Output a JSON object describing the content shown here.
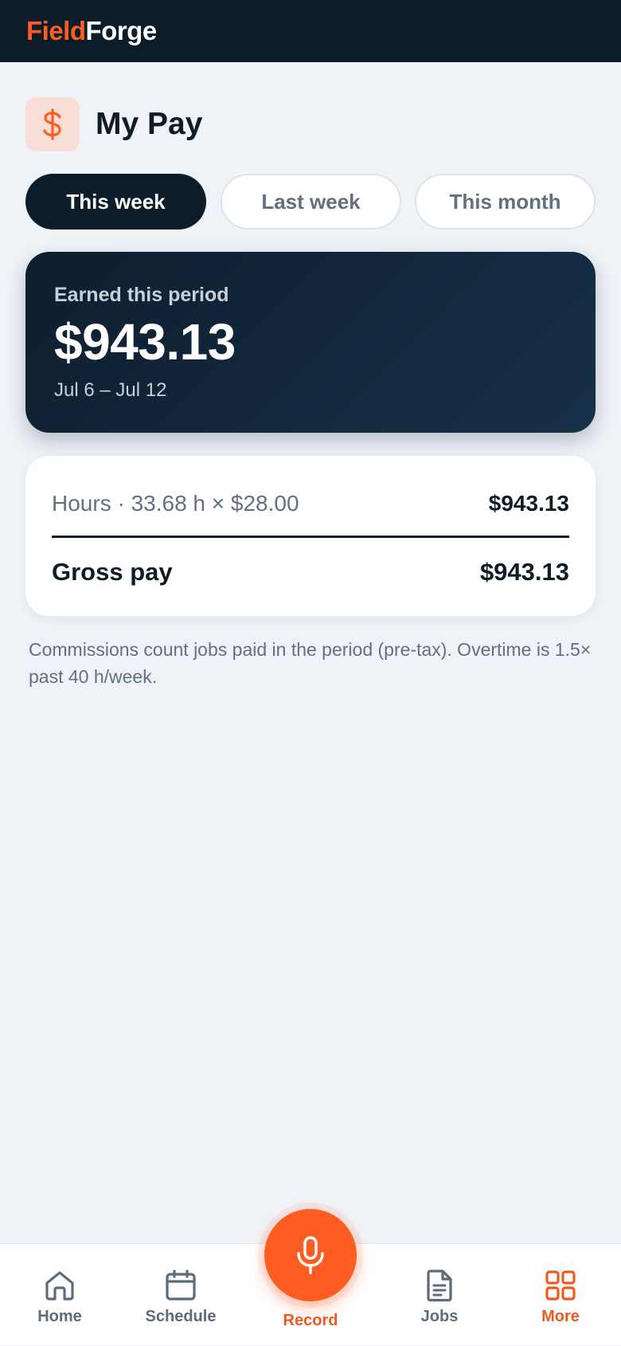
{
  "brand": {
    "part1": "Field",
    "part2": "Forge"
  },
  "page": {
    "title": "My Pay",
    "icon": "dollar-icon"
  },
  "tabs": [
    {
      "label": "This week",
      "active": true
    },
    {
      "label": "Last week",
      "active": false
    },
    {
      "label": "This month",
      "active": false
    }
  ],
  "earnings": {
    "label": "Earned this period",
    "amount": "$943.13",
    "range": "Jul 6 – Jul 12"
  },
  "breakdown": {
    "hours_label": "Hours · 33.68 h × $28.00",
    "hours_value": "$943.13",
    "gross_label": "Gross pay",
    "gross_value": "$943.13"
  },
  "footnote": "Commissions count jobs paid in the period (pre-tax). Overtime is 1.5× past 40 h/week.",
  "nav": {
    "home": "Home",
    "schedule": "Schedule",
    "record": "Record",
    "jobs": "Jobs",
    "more": "More"
  },
  "colors": {
    "accent": "#ff5d22",
    "dark": "#0d1c29",
    "muted": "#627082"
  }
}
